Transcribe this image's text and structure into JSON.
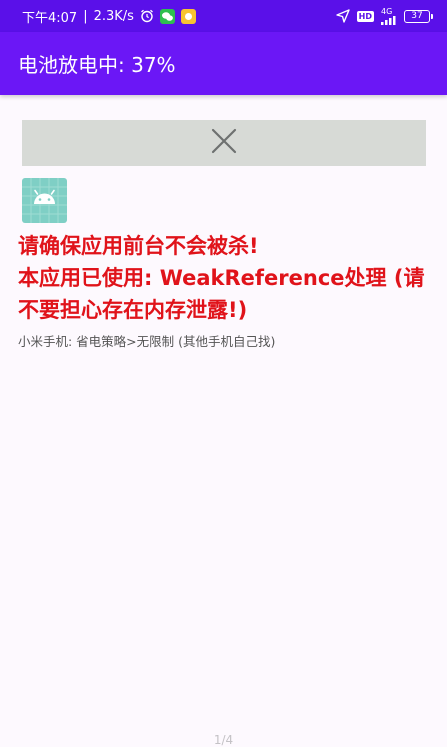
{
  "status_bar": {
    "time": "下午4:07",
    "separator": "|",
    "speed": "2.3K/s",
    "icons_left": [
      "alarm-icon",
      "wechat-icon",
      "notification-app-icon"
    ],
    "network": "4G",
    "hd_label": "HD",
    "battery_level": "37"
  },
  "app_bar": {
    "title": "电池放电中: 37%"
  },
  "close_bar": {
    "icon": "close-icon"
  },
  "content": {
    "warning_line1": "请确保应用前台不会被杀!",
    "warning_line2": "本应用已使用: WeakReference处理 (请不要担心存在内存泄露!)",
    "hint": "小米手机: 省电策略>无限制 (其他手机自己找)"
  },
  "pager": {
    "indicator": "1/4"
  },
  "colors": {
    "status_bar_bg": "#5a10e9",
    "app_bar_bg": "#6b17f6",
    "warning_text": "#e0131a",
    "close_bar_bg": "#d7dad6"
  }
}
